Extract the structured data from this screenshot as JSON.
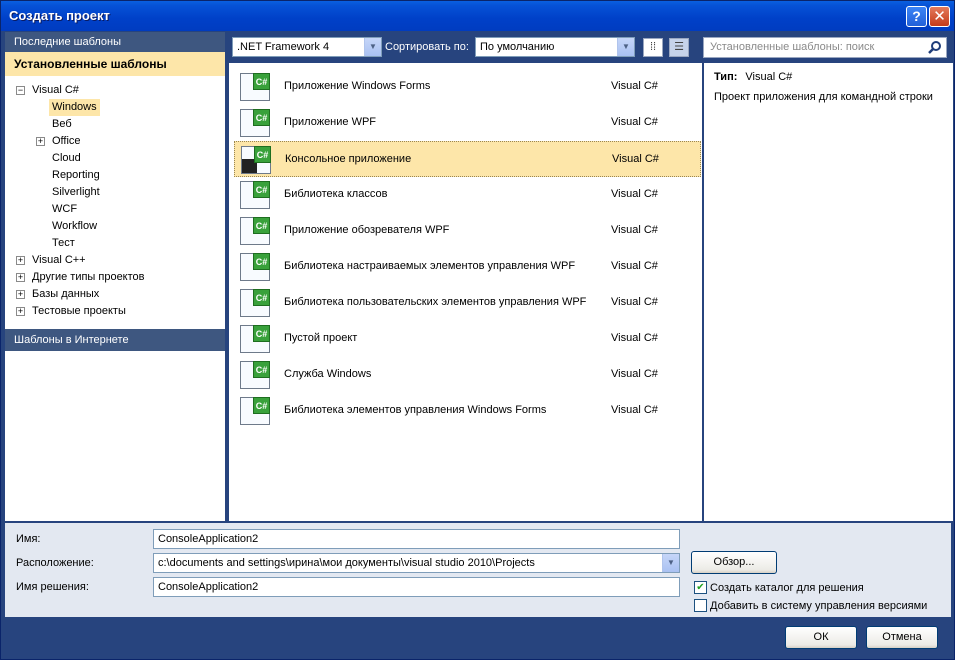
{
  "window": {
    "title": "Создать проект"
  },
  "left_pane": {
    "recent_header": "Последние шаблоны",
    "installed_header": "Установленные шаблоны",
    "online_header": "Шаблоны в Интернете",
    "tree": [
      {
        "label": "Visual C#",
        "level": 0,
        "expander": "−"
      },
      {
        "label": "Windows",
        "level": 1,
        "selected": true
      },
      {
        "label": "Веб",
        "level": 1
      },
      {
        "label": "Office",
        "level": 1,
        "expander": "+"
      },
      {
        "label": "Cloud",
        "level": 1
      },
      {
        "label": "Reporting",
        "level": 1
      },
      {
        "label": "Silverlight",
        "level": 1
      },
      {
        "label": "WCF",
        "level": 1
      },
      {
        "label": "Workflow",
        "level": 1
      },
      {
        "label": "Тест",
        "level": 1
      },
      {
        "label": "Visual C++",
        "level": 0,
        "expander": "+"
      },
      {
        "label": "Другие типы проектов",
        "level": 0,
        "expander": "+"
      },
      {
        "label": "Базы данных",
        "level": 0,
        "expander": "+"
      },
      {
        "label": "Тестовые проекты",
        "level": 0,
        "expander": "+"
      }
    ]
  },
  "toolbar": {
    "framework": ".NET Framework 4",
    "sort_label": "Сортировать по:",
    "sort_value": "По умолчанию",
    "search_placeholder": "Установленные шаблоны: поиск"
  },
  "templates": [
    {
      "name": "Приложение Windows Forms",
      "lang": "Visual C#"
    },
    {
      "name": "Приложение WPF",
      "lang": "Visual C#"
    },
    {
      "name": "Консольное приложение",
      "lang": "Visual C#",
      "selected": true
    },
    {
      "name": "Библиотека классов",
      "lang": "Visual C#"
    },
    {
      "name": "Приложение обозревателя WPF",
      "lang": "Visual C#"
    },
    {
      "name": "Библиотека настраиваемых элементов управления WPF",
      "lang": "Visual C#"
    },
    {
      "name": "Библиотека пользовательских элементов управления WPF",
      "lang": "Visual C#"
    },
    {
      "name": "Пустой проект",
      "lang": "Visual C#"
    },
    {
      "name": "Служба Windows",
      "lang": "Visual C#"
    },
    {
      "name": "Библиотека элементов управления Windows Forms",
      "lang": "Visual C#"
    }
  ],
  "info": {
    "type_label": "Тип:",
    "type_value": "Visual C#",
    "description": "Проект приложения для командной строки"
  },
  "form": {
    "name_label": "Имя:",
    "name_value": "ConsoleApplication2",
    "location_label": "Расположение:",
    "location_value": "c:\\documents and settings\\ирина\\мои документы\\visual studio 2010\\Projects",
    "solution_label": "Имя решения:",
    "solution_value": "ConsoleApplication2",
    "browse_button": "Обзор...",
    "create_dir_label": "Создать каталог для решения",
    "create_dir_checked": true,
    "add_vcs_label": "Добавить в систему управления версиями",
    "add_vcs_checked": false
  },
  "buttons": {
    "ok": "ОК",
    "cancel": "Отмена"
  },
  "icons": [
    "help-icon",
    "close-icon",
    "dropdown-arrow-icon",
    "small-icons-view-icon",
    "list-view-icon",
    "search-icon",
    "csharp-template-icon",
    "expand-icon",
    "collapse-icon"
  ]
}
